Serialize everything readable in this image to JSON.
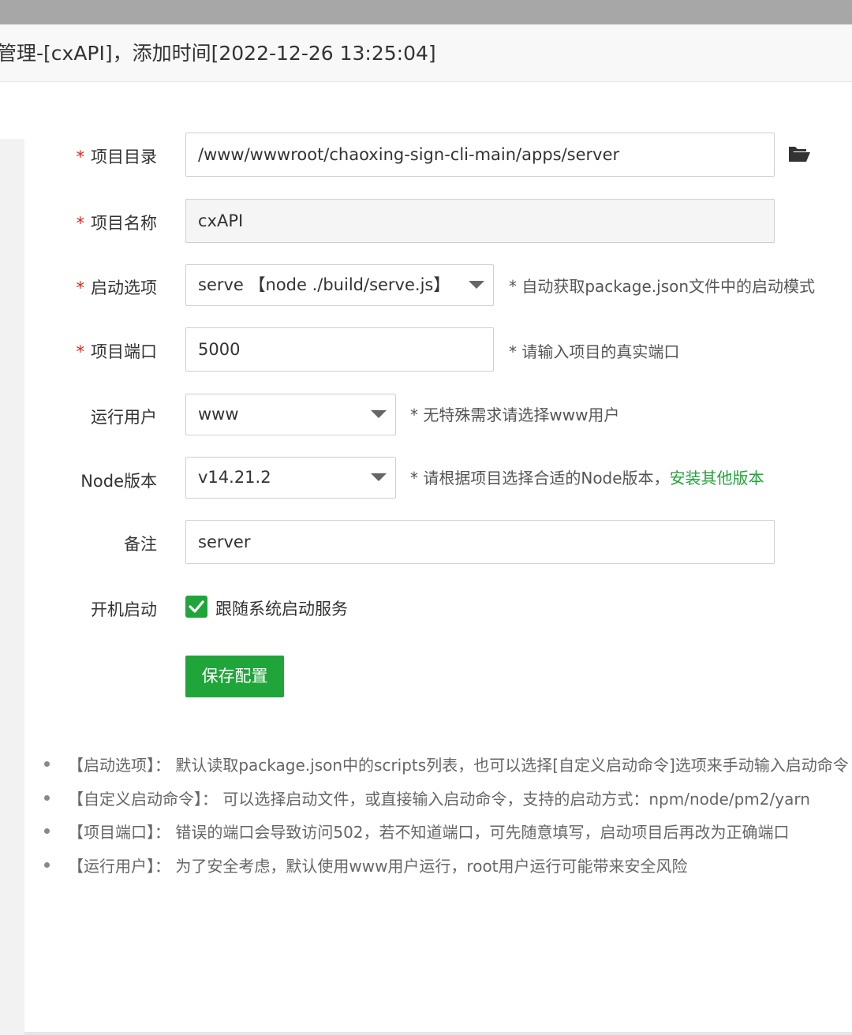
{
  "title": "管理-[cxAPI]，添加时间[2022-12-26 13:25:04]",
  "form": {
    "project_dir": {
      "label": "项目目录",
      "required": true,
      "value": "/www/wwwroot/chaoxing-sign-cli-main/apps/server",
      "icon": "folder-open-icon"
    },
    "project_name": {
      "label": "项目名称",
      "required": true,
      "value": "cxAPI"
    },
    "start_option": {
      "label": "启动选项",
      "required": true,
      "value": "serve 【node ./build/serve.js】",
      "hint": "* 自动获取package.json文件中的启动模式"
    },
    "project_port": {
      "label": "项目端口",
      "required": true,
      "value": "5000",
      "hint": "* 请输入项目的真实端口"
    },
    "run_user": {
      "label": "运行用户",
      "required": false,
      "value": "www",
      "hint": "* 无特殊需求请选择www用户"
    },
    "node_version": {
      "label": "Node版本",
      "required": false,
      "value": "v14.21.2",
      "hint": "* 请根据项目选择合适的Node版本，",
      "hint_link": "安装其他版本"
    },
    "remark": {
      "label": "备注",
      "required": false,
      "value": "server"
    },
    "autostart": {
      "label": "开机启动",
      "checked": true,
      "checkbox_label": "跟随系统启动服务"
    },
    "required_mark": "*",
    "save_label": "保存配置"
  },
  "tips": [
    "【启动选项】： 默认读取package.json中的scripts列表，也可以选择[自定义启动命令]选项来手动输入启动命令",
    "【自定义启动命令】： 可以选择启动文件，或直接输入启动命令，支持的启动方式：npm/node/pm2/yarn",
    "【项目端口】： 错误的端口会导致访问502，若不知道端口，可先随意填写，启动项目后再改为正确端口",
    "【运行用户】： 为了安全考虑，默认使用www用户运行，root用户运行可能带来安全风险"
  ],
  "colors": {
    "accent": "#20a53a",
    "required": "#e2231a"
  }
}
